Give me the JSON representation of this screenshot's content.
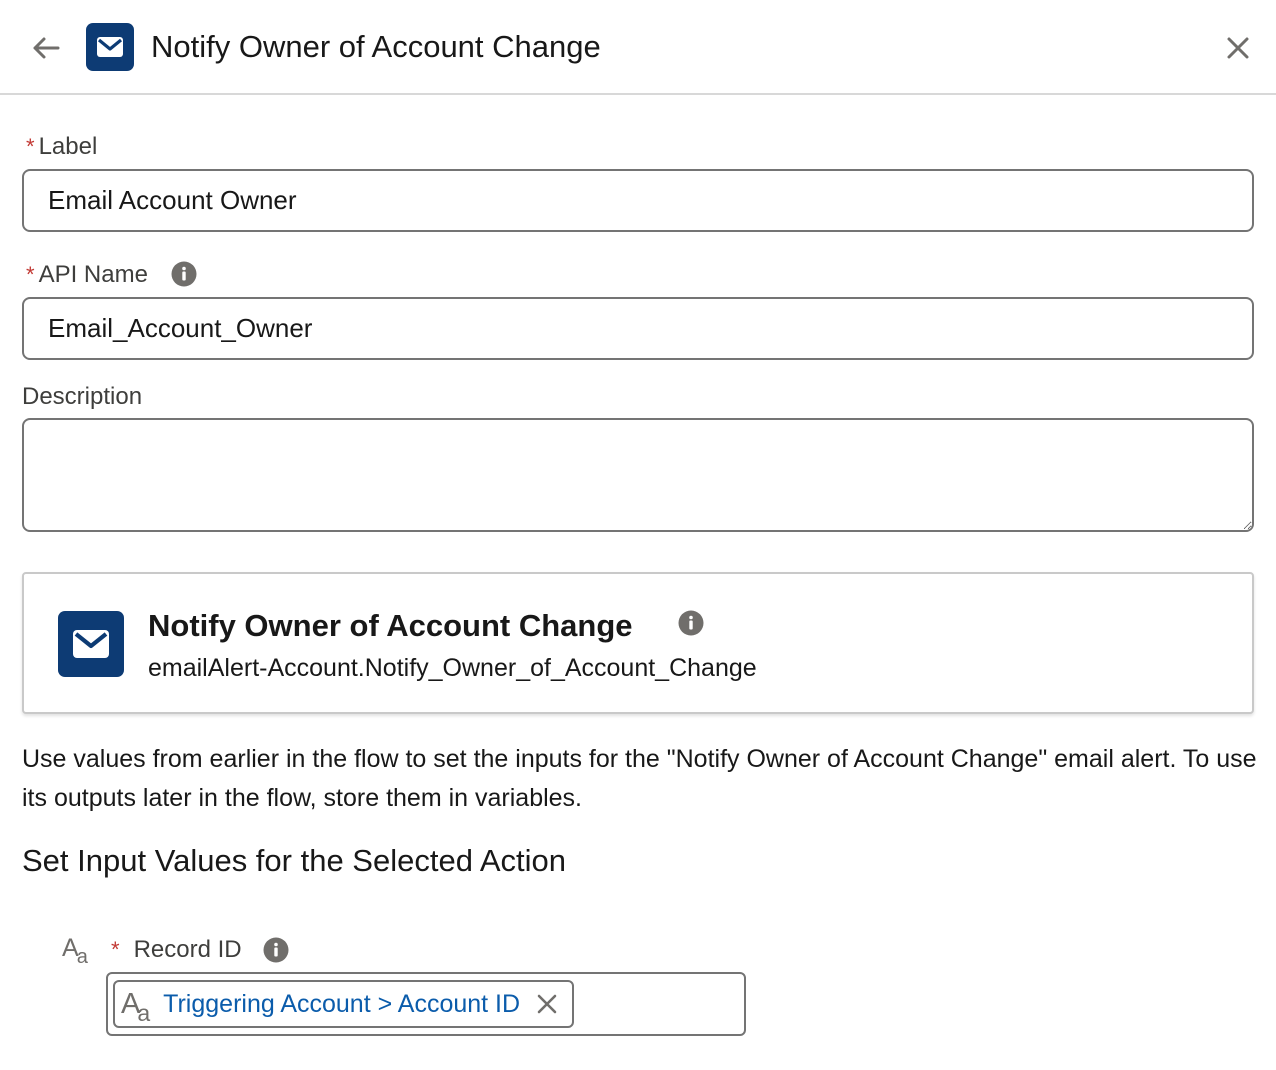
{
  "header": {
    "title": "Notify Owner of Account Change",
    "back_icon": "back-arrow-icon",
    "header_icon": "email-icon",
    "close_icon": "close-icon"
  },
  "form": {
    "required_marker": "*",
    "label_field": {
      "label": "Label",
      "value": "Email Account Owner"
    },
    "api_name_field": {
      "label": "API Name",
      "value": "Email_Account_Owner",
      "info_icon": "info-icon"
    },
    "description_field": {
      "label": "Description",
      "value": ""
    }
  },
  "action_card": {
    "icon": "email-icon",
    "title": "Notify Owner of Account Change",
    "subtitle": "emailAlert-Account.Notify_Owner_of_Account_Change",
    "info_icon": "info-icon"
  },
  "help_text": "Use values from earlier in the flow to set the inputs for the \"Notify Owner of Account Change\" email alert. To use its outputs later in the flow, store them in variables.",
  "section_heading": "Set Input Values for the Selected Action",
  "inputs": {
    "record_id": {
      "type_icon_big": "A",
      "type_icon_small": "a",
      "label": "Record ID",
      "info_icon": "info-icon",
      "pill_text": "Triggering Account > Account ID",
      "remove_icon": "remove-icon"
    }
  },
  "colors": {
    "brand_icon_bg": "#0d3b74",
    "required_red": "#c23934",
    "link_blue": "#0b5cab",
    "border_gray": "#747474"
  }
}
